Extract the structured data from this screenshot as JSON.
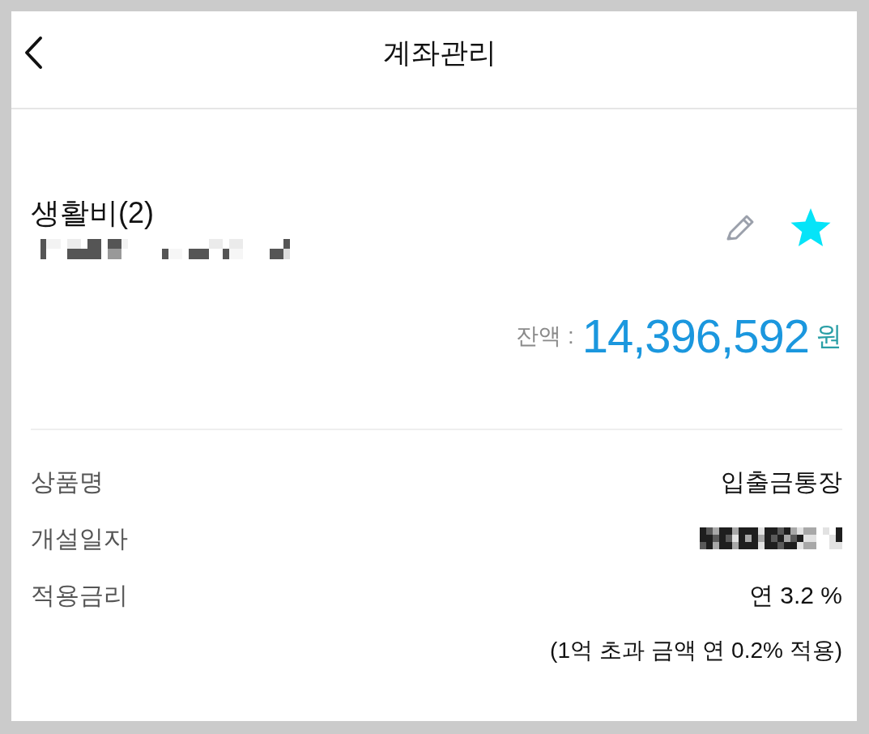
{
  "header": {
    "title": "계좌관리"
  },
  "account": {
    "name": "생활비(2)",
    "number_redacted": true,
    "favorite": true,
    "balance_label": "잔액 :",
    "balance": "14,396,592",
    "currency": "원"
  },
  "details": [
    {
      "label": "상품명",
      "value": "입출금통장",
      "redacted": false
    },
    {
      "label": "개설일자",
      "redacted": true
    },
    {
      "label": "적용금리",
      "value": "연 3.2 %",
      "redacted": false
    }
  ],
  "note": "(1억 초과 금액 연 0.2% 적용)"
}
